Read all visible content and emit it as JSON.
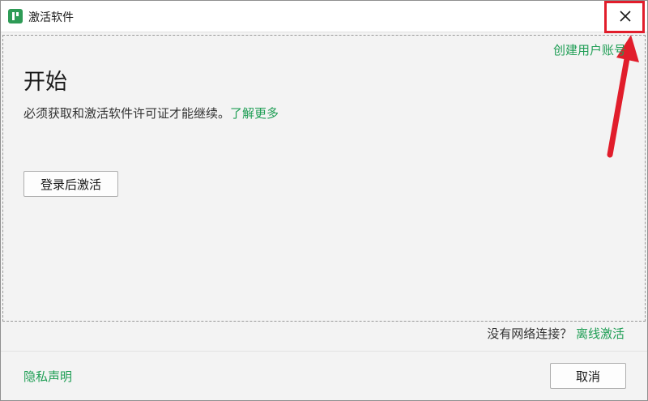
{
  "window": {
    "title": "激活软件",
    "close_glyph": "✕"
  },
  "header": {
    "create_account_link": "创建用户账号"
  },
  "main": {
    "heading": "开始",
    "description": "必须获取和激活软件许可证才能继续。",
    "learn_more_link": "了解更多",
    "login_activate_button": "登录后激活"
  },
  "offline": {
    "question": "没有网络连接？",
    "offline_activate_link": "离线激活"
  },
  "footer": {
    "privacy_link": "隐私声明",
    "cancel_button": "取消"
  },
  "colors": {
    "accent_green": "#1f9e55",
    "highlight_red": "#e11d2b"
  },
  "icons": {
    "app_logo": "app-logo-icon",
    "close": "close-icon",
    "annotation_arrow": "arrow-annotation-icon"
  }
}
